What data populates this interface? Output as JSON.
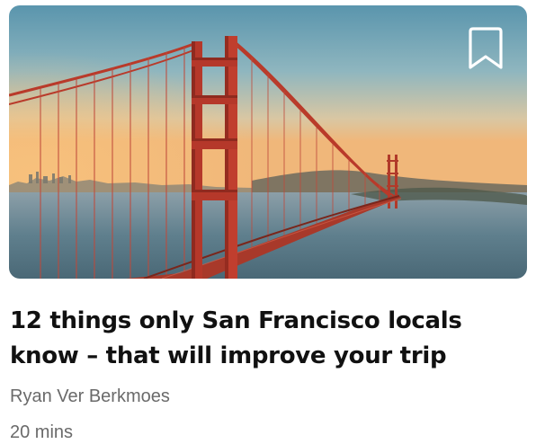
{
  "article": {
    "title": "12 things only San Francisco locals know – that will improve your trip",
    "author": "Ryan Ver Berkmoes",
    "duration": "20 mins"
  },
  "hero_image": {
    "subject": "Golden Gate Bridge at sunset"
  },
  "icons": {
    "bookmark": "bookmark-icon"
  },
  "colors": {
    "bridge": "#c0392b",
    "text_primary": "#111111",
    "text_secondary": "#6a6a6a"
  }
}
